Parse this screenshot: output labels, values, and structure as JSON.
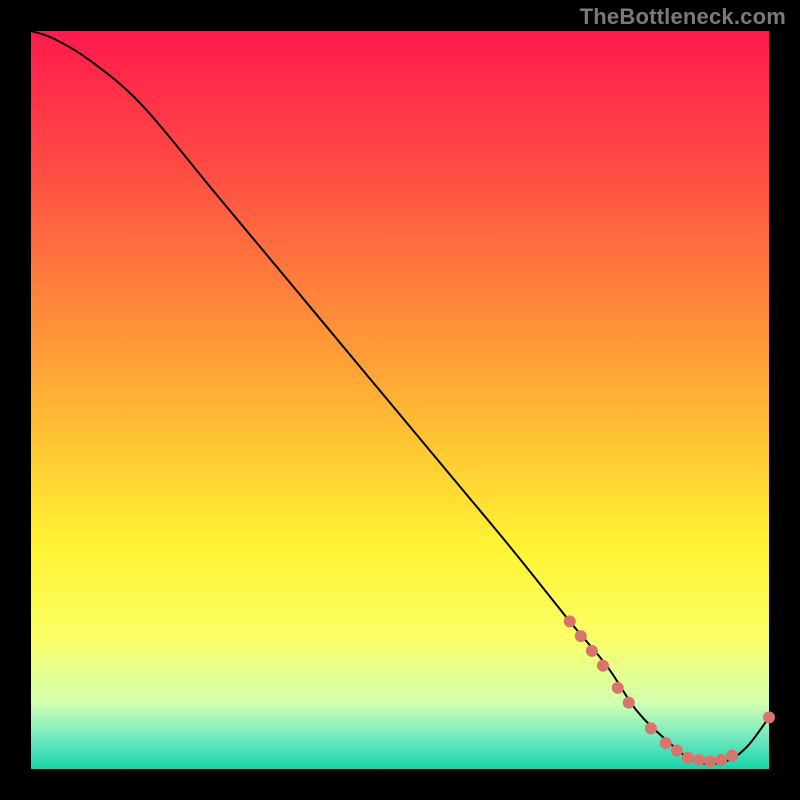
{
  "watermark": "TheBottleneck.com",
  "tiny_label": "",
  "chart_data": {
    "type": "line",
    "title": "",
    "xlabel": "",
    "ylabel": "",
    "xlim": [
      0,
      100
    ],
    "ylim": [
      0,
      100
    ],
    "series": [
      {
        "name": "curve",
        "x": [
          0,
          3,
          8,
          15,
          25,
          35,
          45,
          55,
          65,
          73,
          78,
          82,
          86,
          90,
          94,
          97,
          100
        ],
        "y": [
          100,
          99,
          96,
          90,
          78,
          66,
          54,
          42,
          30,
          20,
          14,
          8,
          4,
          1,
          1,
          3,
          7
        ]
      }
    ],
    "markers": [
      {
        "x": 73.0,
        "y": 20.0
      },
      {
        "x": 74.5,
        "y": 18.0
      },
      {
        "x": 76.0,
        "y": 16.0
      },
      {
        "x": 77.5,
        "y": 14.0
      },
      {
        "x": 79.5,
        "y": 11.0
      },
      {
        "x": 81.0,
        "y": 9.0
      },
      {
        "x": 84.0,
        "y": 5.5
      },
      {
        "x": 86.0,
        "y": 3.5
      },
      {
        "x": 87.5,
        "y": 2.5
      },
      {
        "x": 89.0,
        "y": 1.5
      },
      {
        "x": 90.5,
        "y": 1.2
      },
      {
        "x": 92.0,
        "y": 1.0
      },
      {
        "x": 93.5,
        "y": 1.2
      },
      {
        "x": 95.0,
        "y": 1.8
      },
      {
        "x": 100.0,
        "y": 7.0
      }
    ],
    "marker_color": "#d9746a",
    "line_color": "#000000",
    "line_width": 2
  }
}
